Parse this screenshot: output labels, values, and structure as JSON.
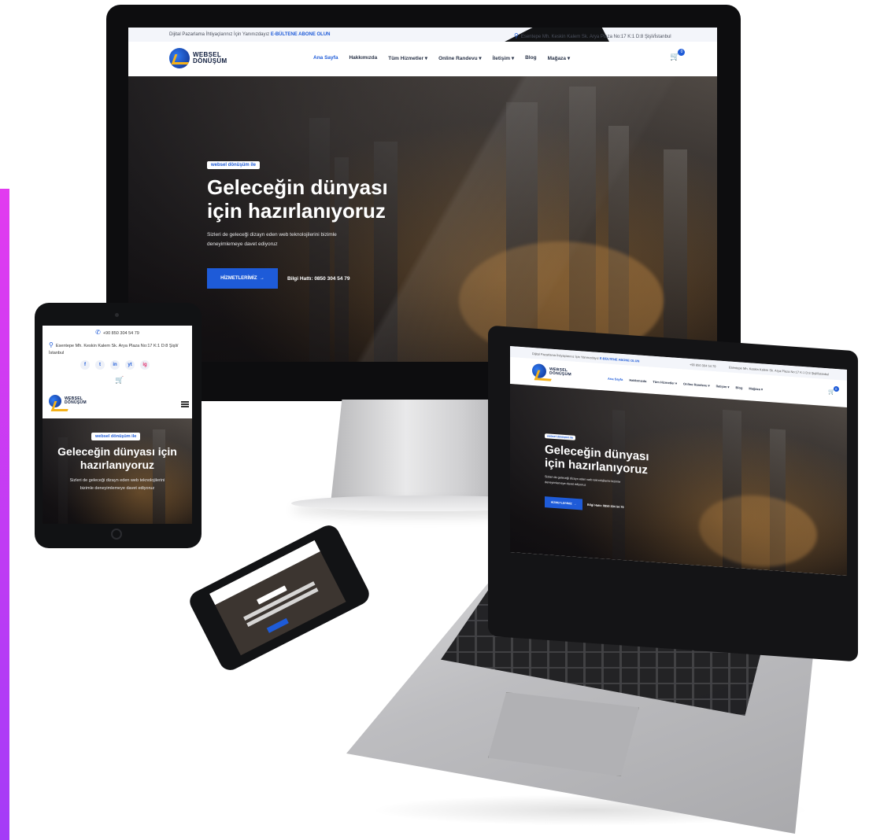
{
  "site": {
    "logo_line1": "WEBSEL",
    "logo_line2": "DÖNÜŞÜM"
  },
  "topbar": {
    "promo_text": "Dijital Pazarlama İhtiyaçlarınız İçin Yanınızdayız",
    "promo_link": "E-BÜLTENE ABONE OLUN",
    "phone": "+90 850 304 54 79",
    "address": "Esentepe Mh. Keskin Kalem Sk. Arya Plaza No:17 K:1 D:8 Şişli/İstanbul"
  },
  "nav": {
    "items": [
      {
        "label": "Ana Sayfa",
        "active": true
      },
      {
        "label": "Hakkımızda"
      },
      {
        "label": "Tüm Hizmetler ▾"
      },
      {
        "label": "Online Randevu ▾"
      },
      {
        "label": "İletişim ▾"
      },
      {
        "label": "Blog"
      },
      {
        "label": "Mağaza ▾"
      }
    ],
    "cart_count": "0"
  },
  "hero": {
    "tag": "websel dönüşüm ile",
    "title_line1": "Geleceğin dünyası",
    "title_line2": "için hazırlanıyoruz",
    "subtitle_line1": "Sizleri de geleceği dizayn eden web teknolojilerini bizimle",
    "subtitle_line2": "deneyimlemeye davet ediyoruz",
    "cta_label": "HİZMETLERİMİZ",
    "hotline_label": "Bilgi Hattı:",
    "hotline_number": "0850 304 54 79"
  },
  "tablet": {
    "phone": "+90 850 304 54 79",
    "address": "Esentepe Mh. Keskin Kalem Sk. Arya Plaza No:17 K:1 D:8 Şişli/İstanbul",
    "title_line1": "Geleceğin dünyası için",
    "title_line2": "hazırlanıyoruz",
    "subtitle_line1": "Sizleri de geleceği dizayn eden web teknolojilerini",
    "subtitle_line2": "bizimle deneyimlemeye davet ediyoruz"
  },
  "social": [
    "f",
    "t",
    "in",
    "yt",
    "ig"
  ],
  "colors": {
    "accent": "#1e5bd8",
    "strip_top": "#e23bf0",
    "strip_bottom": "#a43cf7",
    "logo_yellow": "#f5b21a"
  }
}
